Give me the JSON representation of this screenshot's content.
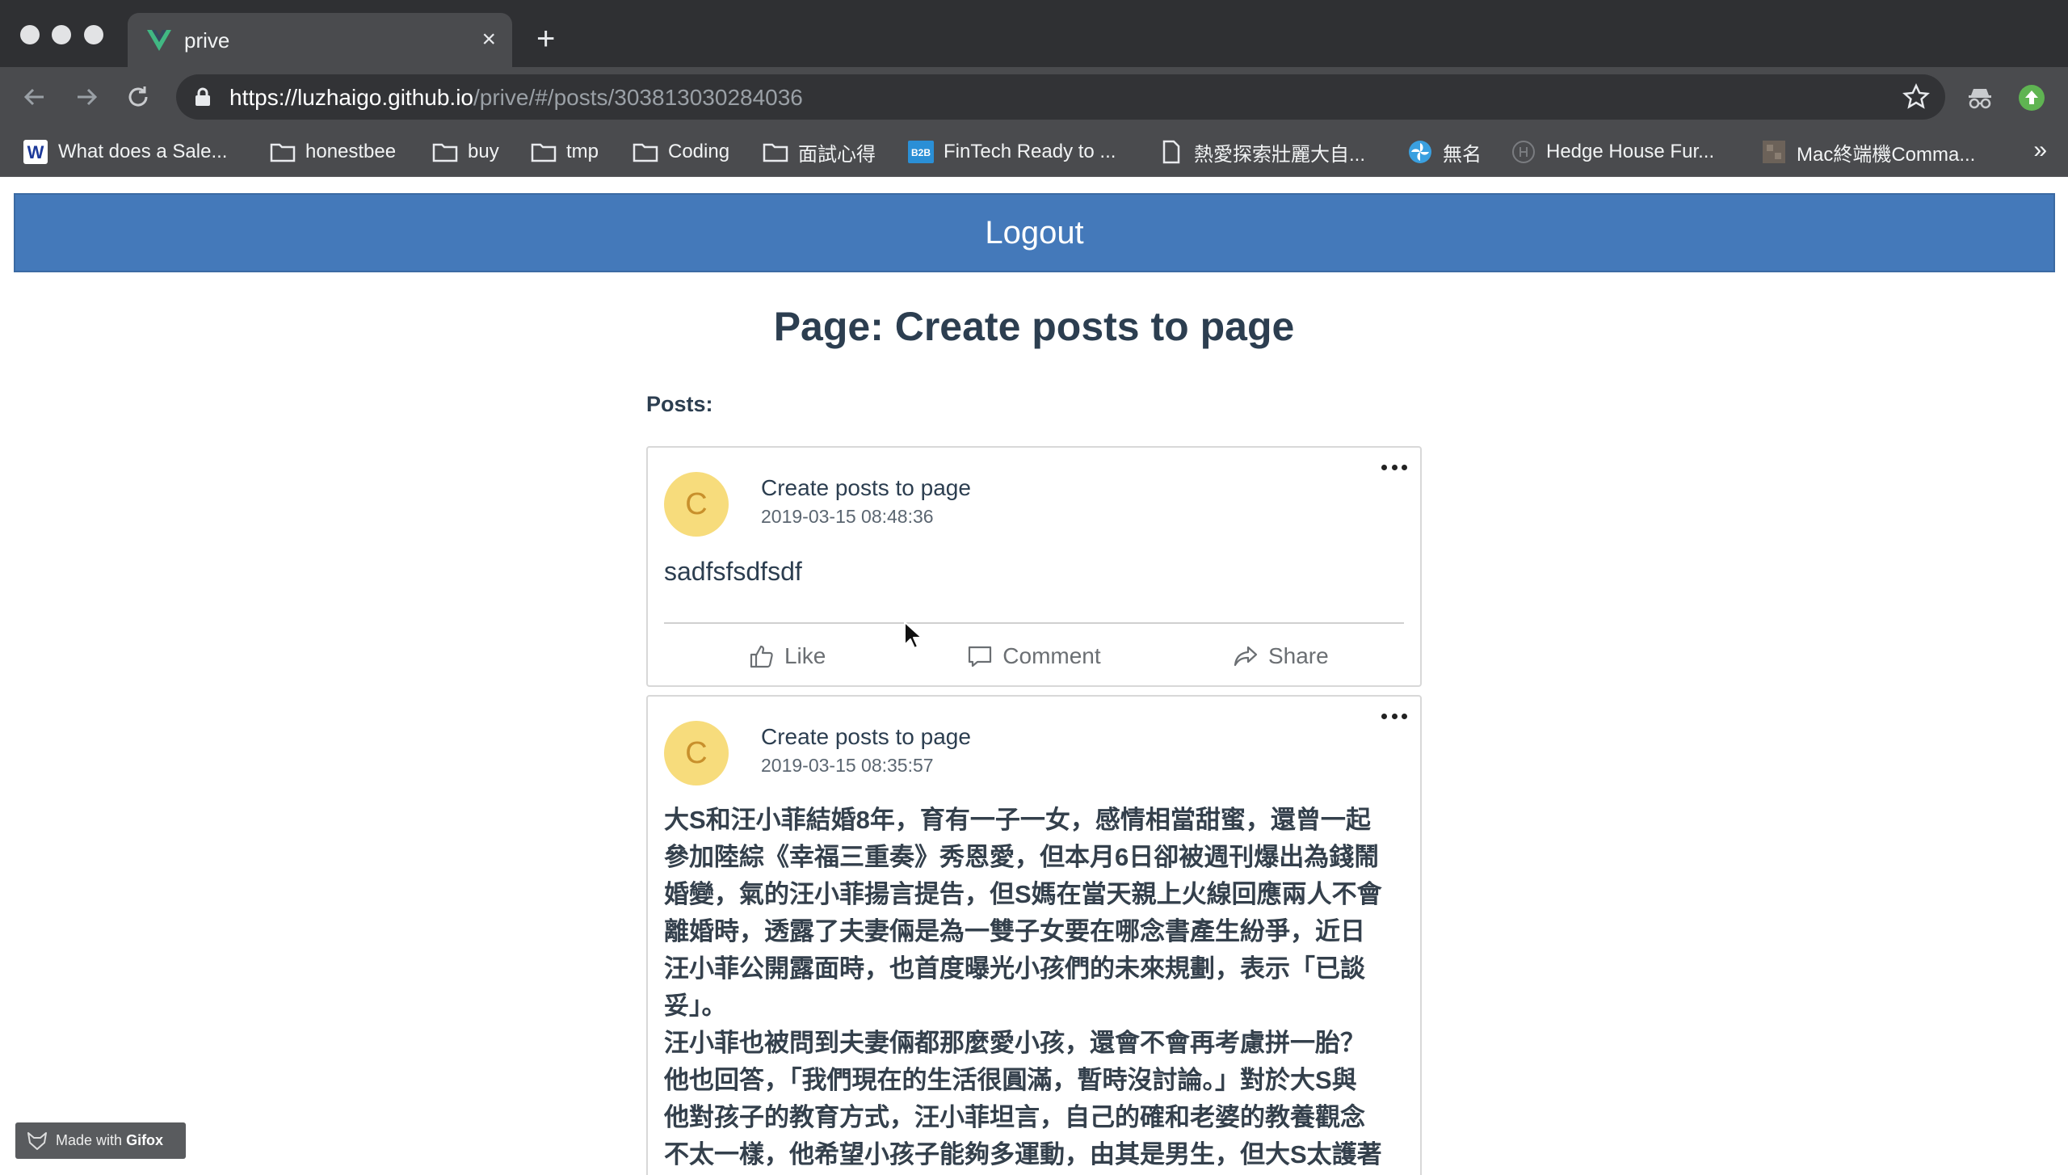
{
  "browser": {
    "tab_title": "prive",
    "tab_close": "×",
    "new_tab": "+",
    "url_host": "https://luzhaigo.github.io",
    "url_path": "/prive/#/posts/303813030284036",
    "bookmarks": [
      {
        "label": "What does a Sale...",
        "icon": "w-logo-icon"
      },
      {
        "label": "honestbee",
        "icon": "folder-icon"
      },
      {
        "label": "buy",
        "icon": "folder-icon"
      },
      {
        "label": "tmp",
        "icon": "folder-icon"
      },
      {
        "label": "Coding",
        "icon": "folder-icon"
      },
      {
        "label": "面試心得",
        "icon": "folder-icon"
      },
      {
        "label": "FinTech Ready to ...",
        "icon": "b2b-icon",
        "badge": "B2B"
      },
      {
        "label": "熱愛探索壯麗大自...",
        "icon": "page-icon"
      },
      {
        "label": "無名",
        "icon": "pinwheel-icon"
      },
      {
        "label": "Hedge House Fur...",
        "icon": "circle-h-icon"
      },
      {
        "label": "Mac終端機Comma...",
        "icon": "square-thumb-icon"
      }
    ],
    "bookmarks_more": "»"
  },
  "header": {
    "logout_label": "Logout"
  },
  "page": {
    "title": "Page: Create posts to page",
    "posts_label": "Posts:"
  },
  "posts": [
    {
      "avatar_letter": "C",
      "author": "Create posts to page",
      "time": "2019-03-15 08:48:36",
      "body": "sadfsfsdfsdf"
    },
    {
      "avatar_letter": "C",
      "author": "Create posts to page",
      "time": "2019-03-15 08:35:57",
      "lines": [
        "大S和汪小菲結婚8年，育有一子一女，感情相當甜蜜，還曾一起",
        "參加陸綜《幸福三重奏》秀恩愛，但本月6日卻被週刊爆出為錢鬧",
        "婚變，氣的汪小菲揚言提告，但S媽在當天親上火線回應兩人不會",
        "離婚時，透露了夫妻倆是為一雙子女要在哪念書產生紛爭，近日",
        "汪小菲公開露面時，也首度曝光小孩們的未來規劃，表示「已談",
        "妥」。",
        "汪小菲也被問到夫妻倆都那麼愛小孩，還會不會再考慮拼一胎？",
        "他也回答，「我們現在的生活很圓滿，暫時沒討論。」對於大S與",
        "他對孩子的教育方式，汪小菲坦言，自己的確和老婆的教養觀念",
        "不太一樣，他希望小孩子能夠多運動，由其是男生，但大S太護著"
      ]
    }
  ],
  "actions": {
    "like": "Like",
    "comment": "Comment",
    "share": "Share"
  },
  "watermark": {
    "prefix": "Made with",
    "brand": "Gifox"
  },
  "colors": {
    "header_blue": "#4479ba",
    "avatar_yellow": "#f7dc7c",
    "chrome_dark": "#2f3033",
    "chrome_toolbar": "#4a4b4e"
  }
}
